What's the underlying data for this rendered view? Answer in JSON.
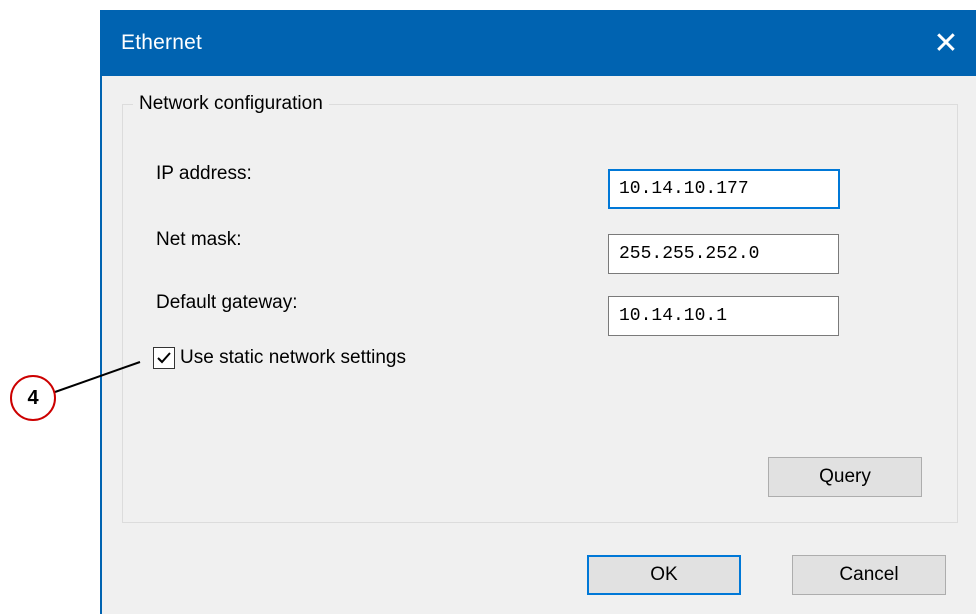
{
  "window": {
    "title": "Ethernet",
    "close_glyph": "✕"
  },
  "group": {
    "legend": "Network configuration"
  },
  "fields": {
    "ip_address": {
      "label": "IP address:",
      "value": "10.14.10.177"
    },
    "net_mask": {
      "label": "Net mask:",
      "value": "255.255.252.0"
    },
    "default_gateway": {
      "label": "Default gateway:",
      "value": "10.14.10.1"
    }
  },
  "static_settings": {
    "label": "Use static network settings",
    "checked": true
  },
  "buttons": {
    "query": "Query",
    "ok": "OK",
    "cancel": "Cancel"
  },
  "annotation": {
    "number": "4",
    "color": "#cc0000"
  },
  "colors": {
    "titlebar": "#0063b1",
    "dialog_bg": "#f0f0f0",
    "focus": "#0078d7"
  }
}
